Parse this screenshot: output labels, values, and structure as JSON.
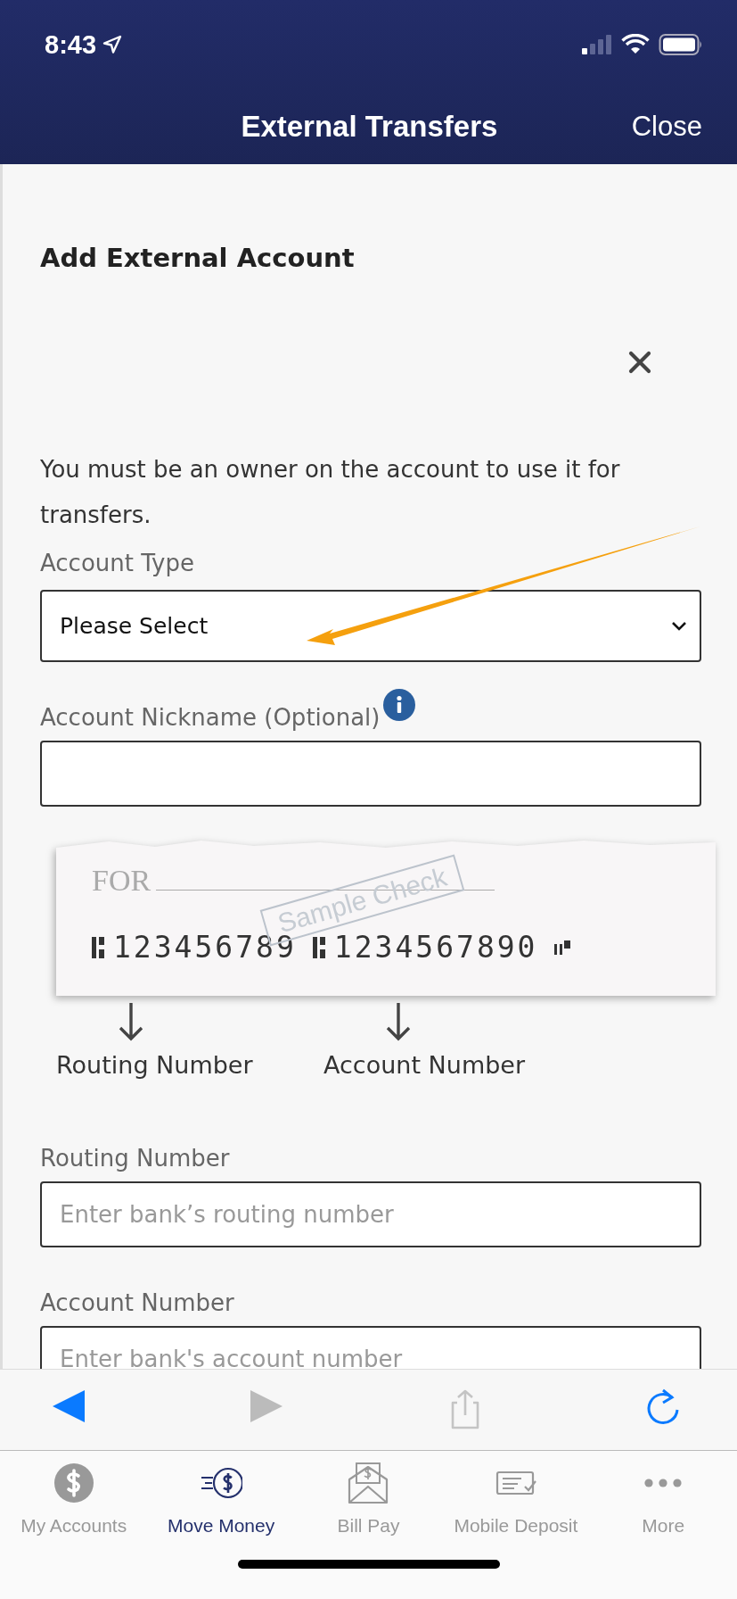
{
  "status_bar": {
    "time": "8:43"
  },
  "nav_bar": {
    "title": "External Transfers",
    "close": "Close"
  },
  "form": {
    "heading": "Add External Account",
    "notice": "You must be an owner on the account to use it for transfers.",
    "items": [
      {
        "kind": "select",
        "label": "Account Type",
        "value": "Please Select"
      },
      {
        "kind": "text",
        "label": "Account Nickname (Optional)",
        "info": true
      },
      {
        "kind": "check_diagram",
        "memo_label": "FOR",
        "stamp": "Sample Check",
        "routing_digits": "123456789",
        "account_digits": "1234567890",
        "routing_caption": "Routing Number",
        "account_caption": "Account Number"
      },
      {
        "kind": "text",
        "label": "Routing Number",
        "placeholder": "Enter bank’s routing number"
      },
      {
        "kind": "text",
        "label": "Account Number",
        "placeholder": "Enter bank's account number"
      }
    ]
  },
  "annotation": {
    "kind": "arrow"
  },
  "browser_toolbar": [
    {
      "kind": "back",
      "disabled": false
    },
    {
      "kind": "forward",
      "disabled": true
    },
    {
      "kind": "share",
      "disabled": true
    },
    {
      "kind": "reload",
      "disabled": false
    }
  ],
  "tab_bar": [
    {
      "kind": "accounts",
      "label": "My Accounts",
      "selected": false
    },
    {
      "kind": "move",
      "label": "Move Money",
      "selected": true
    },
    {
      "kind": "billpay",
      "label": "Bill Pay",
      "selected": false
    },
    {
      "kind": "deposit",
      "label": "Mobile Deposit",
      "selected": false
    },
    {
      "kind": "more",
      "label": "More",
      "selected": false
    }
  ]
}
